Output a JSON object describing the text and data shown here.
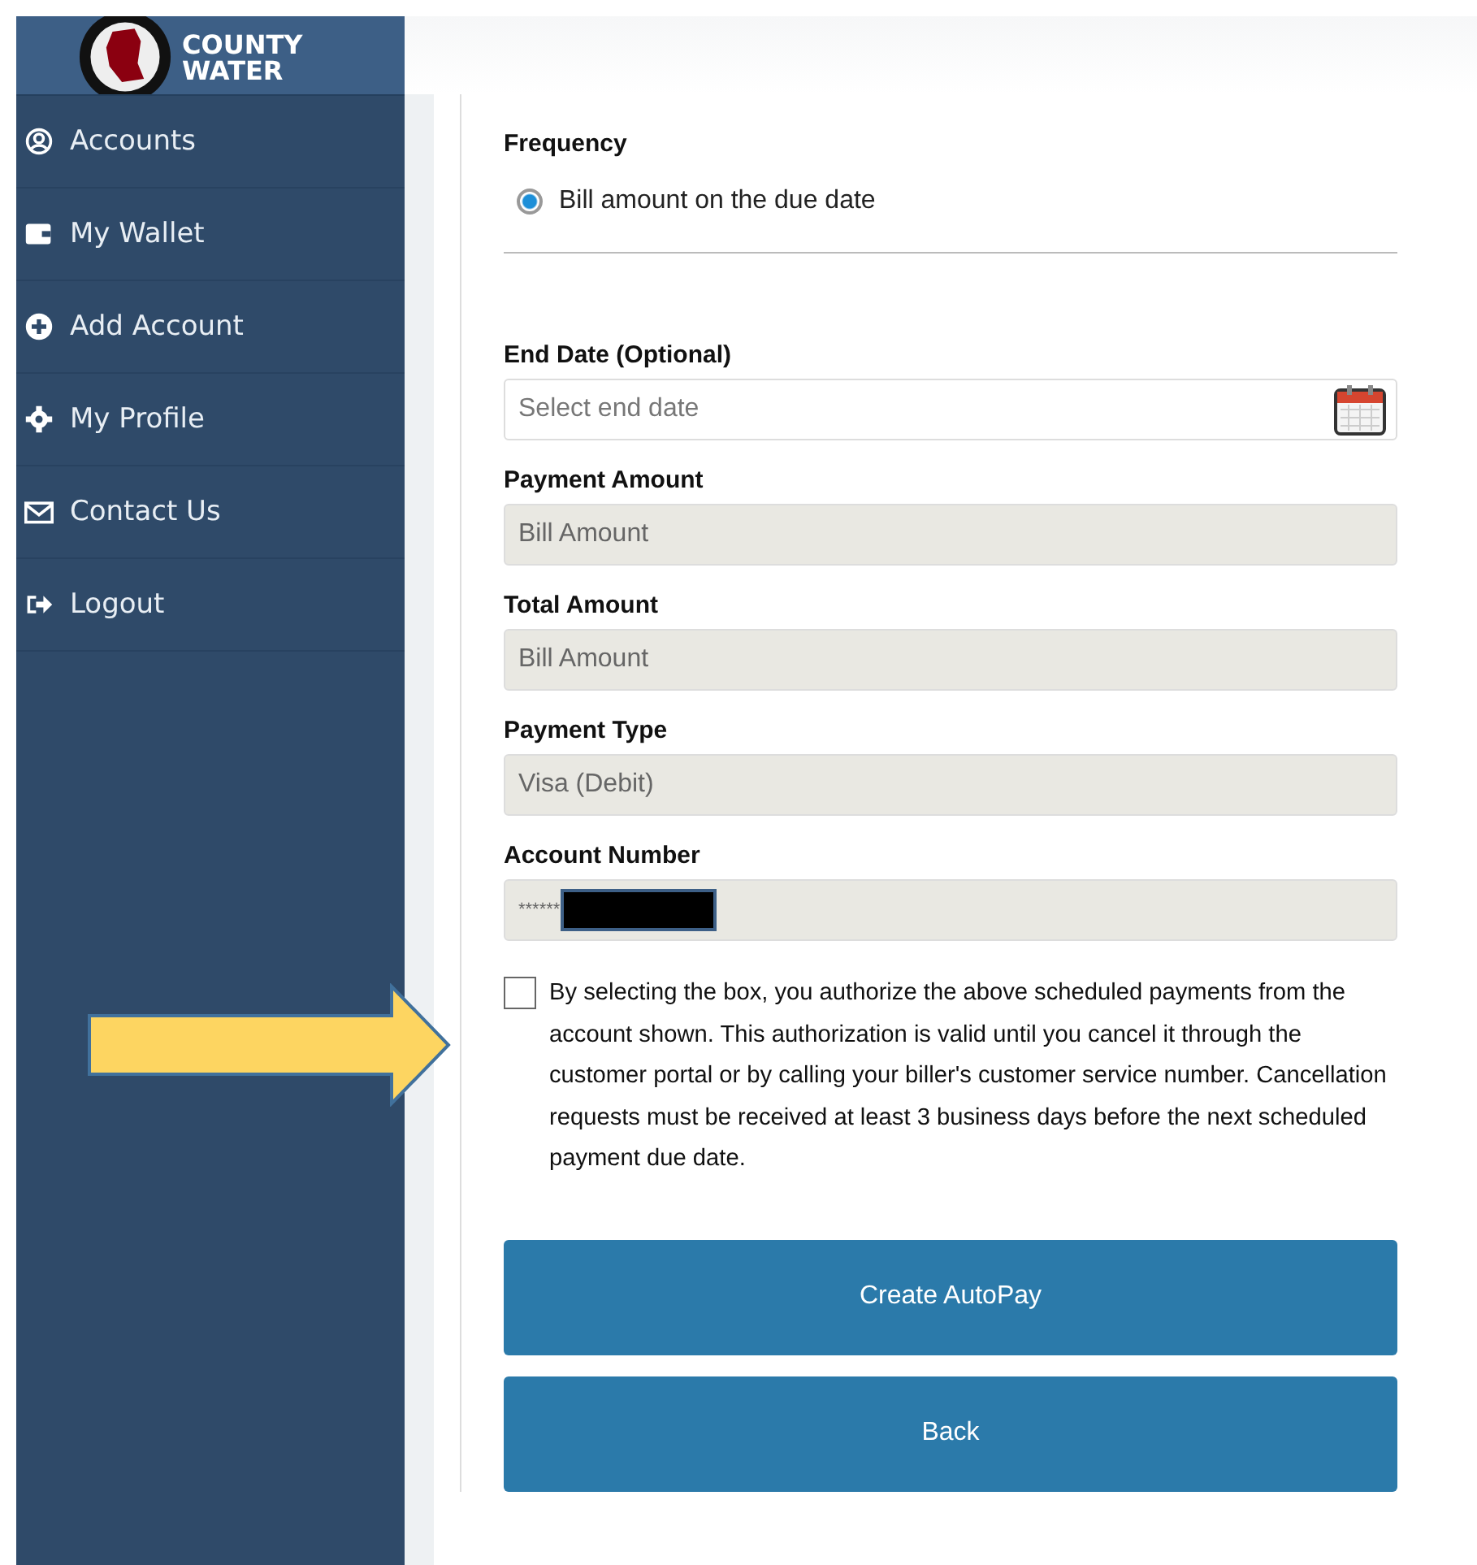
{
  "logo": {
    "lines": [
      "COUNTY",
      "WATER"
    ]
  },
  "sidebar": {
    "items": [
      {
        "label": "Accounts",
        "kind": "user"
      },
      {
        "label": "My Wallet",
        "kind": "wallet"
      },
      {
        "label": "Add Account",
        "kind": "plus"
      },
      {
        "label": "My Profile",
        "kind": "gear"
      },
      {
        "label": "Contact Us",
        "kind": "mail"
      },
      {
        "label": "Logout",
        "kind": "logout"
      }
    ]
  },
  "form": {
    "frequency": {
      "label": "Frequency",
      "options": [
        {
          "label": "Bill amount on the due date",
          "selected": true
        }
      ]
    },
    "end_date": {
      "label": "End Date (Optional)",
      "placeholder": "Select end date"
    },
    "fields": [
      {
        "label": "Payment Amount",
        "value": "Bill Amount"
      },
      {
        "label": "Total Amount",
        "value": "Bill Amount"
      },
      {
        "label": "Payment Type",
        "value": "Visa (Debit)"
      },
      {
        "label": "Account Number",
        "value": "******",
        "redacted": true
      }
    ],
    "consent": {
      "checked": false,
      "text": "By selecting the box, you authorize the above scheduled payments from the account shown. This authorization is valid until you cancel it through the customer portal or by calling your biller's customer service number. Cancellation requests must be received at least 3 business days before the next scheduled payment due date."
    },
    "buttons": [
      "Create AutoPay",
      "Back"
    ]
  }
}
